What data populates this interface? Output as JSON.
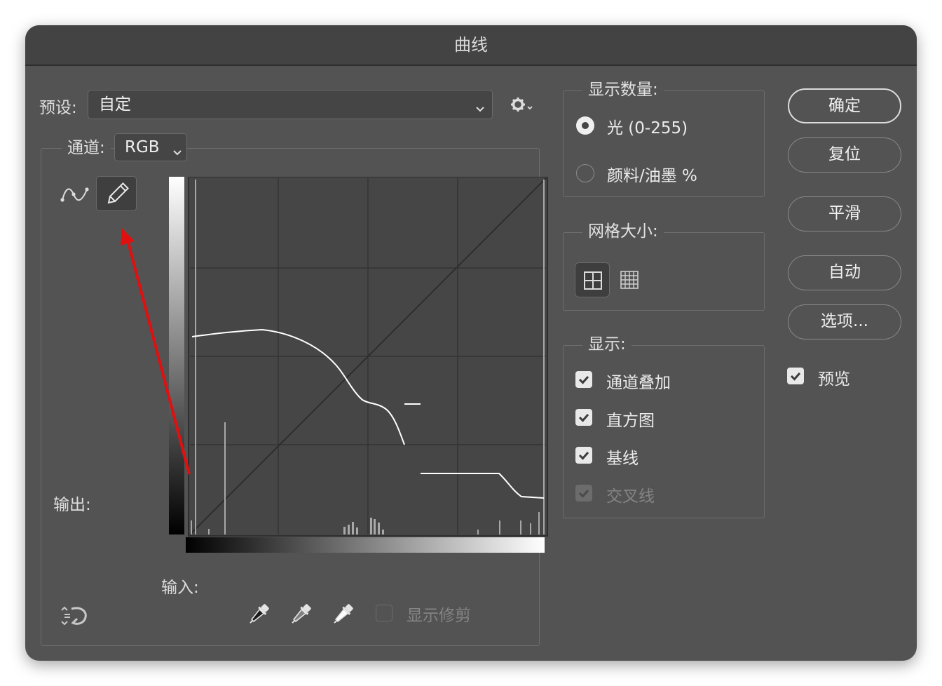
{
  "dialog": {
    "title": "曲线"
  },
  "preset": {
    "label": "预设:",
    "value": "自定"
  },
  "channel": {
    "label": "通道:",
    "value": "RGB"
  },
  "curve": {
    "output_label": "输出:",
    "input_label": "输入:"
  },
  "display_amount": {
    "title": "显示数量:",
    "options": [
      {
        "label": "光 (0-255)",
        "selected": true
      },
      {
        "label": "颜料/油墨 %",
        "selected": false
      }
    ]
  },
  "grid_size": {
    "title": "网格大小:"
  },
  "show": {
    "title": "显示:",
    "items": [
      {
        "label": "通道叠加",
        "checked": true,
        "enabled": true
      },
      {
        "label": "直方图",
        "checked": true,
        "enabled": true
      },
      {
        "label": "基线",
        "checked": true,
        "enabled": true
      },
      {
        "label": "交叉线",
        "checked": true,
        "enabled": false
      }
    ]
  },
  "buttons": {
    "ok": "确定",
    "reset": "复位",
    "smooth": "平滑",
    "auto": "自动",
    "options": "选项..."
  },
  "preview": {
    "label": "预览",
    "checked": true
  },
  "show_clipping": {
    "label": "显示修剪",
    "checked": false
  },
  "colors": {
    "dialog_bg": "#535353",
    "graph_bg": "#464646",
    "curve": "#ffffff",
    "annotation_arrow": "#e01010"
  }
}
